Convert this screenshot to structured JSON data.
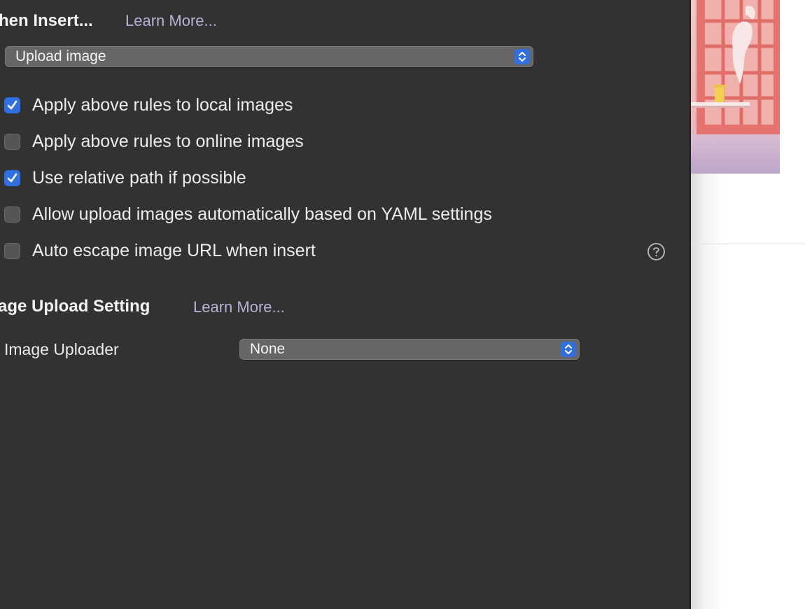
{
  "insert_section": {
    "title": "hen Insert...",
    "learn_more": "Learn More...",
    "action_select": {
      "value": "Upload image"
    }
  },
  "options": [
    {
      "label": "Apply above rules to local images",
      "checked": true
    },
    {
      "label": "Apply above rules to online images",
      "checked": false
    },
    {
      "label": "Use relative path if possible",
      "checked": true
    },
    {
      "label": "Allow upload images automatically based on YAML settings",
      "checked": false
    },
    {
      "label": "Auto escape image URL when insert",
      "checked": false
    }
  ],
  "upload_section": {
    "title": "age Upload Setting",
    "learn_more": "Learn More...",
    "uploader_label": "Image Uploader",
    "uploader_select": {
      "value": "None"
    }
  },
  "icons": {
    "select_stepper": "chevron-up-down-icon",
    "checkmark": "checkmark-icon",
    "help": "question-circle-icon"
  },
  "colors": {
    "panel_background": "#323232",
    "accent": "#2f6fe0",
    "link": "#b9b2d6",
    "select_background": "#666666"
  }
}
